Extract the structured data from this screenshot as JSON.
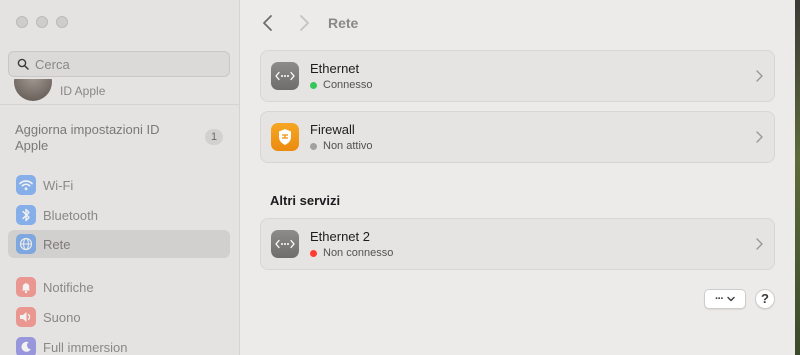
{
  "sidebar": {
    "search": {
      "placeholder": "Cerca"
    },
    "profile": {
      "label": "ID Apple"
    },
    "update": {
      "text": "Aggiorna impostazioni ID Apple",
      "badge": "1"
    },
    "items": [
      {
        "label": "Wi-Fi",
        "icon": "wifi-icon",
        "selected": false
      },
      {
        "label": "Bluetooth",
        "icon": "bluetooth-icon",
        "selected": false
      },
      {
        "label": "Rete",
        "icon": "globe-icon",
        "selected": true
      },
      {
        "label": "Notifiche",
        "icon": "bell-icon",
        "selected": false
      },
      {
        "label": "Suono",
        "icon": "speaker-icon",
        "selected": false
      },
      {
        "label": "Full immersion",
        "icon": "moon-icon",
        "selected": false
      }
    ]
  },
  "toolbar": {
    "title": "Rete"
  },
  "services": [
    {
      "name": "Ethernet",
      "status": "Connesso",
      "status_color": "#34c759",
      "icon": "ethernet-icon"
    },
    {
      "name": "Firewall",
      "status": "Non attivo",
      "status_color": "#a1a1a1",
      "icon": "shield-icon"
    }
  ],
  "other_services": {
    "title": "Altri servizi",
    "items": [
      {
        "name": "Ethernet 2",
        "status": "Non connesso",
        "status_color": "#ff3b30",
        "icon": "ethernet-icon"
      }
    ]
  },
  "footer": {
    "more_label": "···",
    "help_label": "?"
  }
}
